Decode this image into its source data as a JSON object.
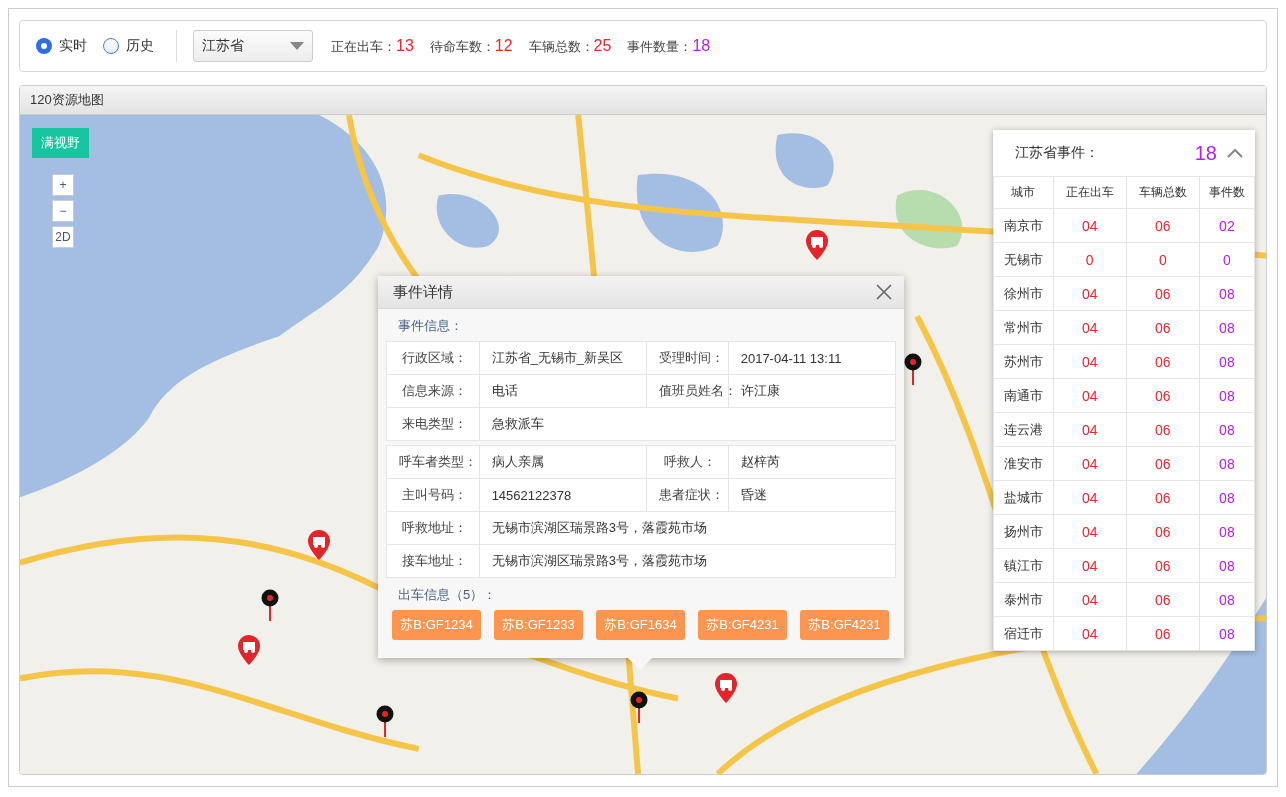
{
  "toolbar": {
    "mode_options": [
      {
        "label": "实时",
        "selected": true
      },
      {
        "label": "历史",
        "selected": false
      }
    ],
    "province_select": {
      "value": "江苏省"
    },
    "stats": [
      {
        "label": "正在出车：",
        "value": "13",
        "color": "#e8262d"
      },
      {
        "label": "待命车数：",
        "value": "12",
        "color": "#e8262d"
      },
      {
        "label": "车辆总数：",
        "value": "25",
        "color": "#e8262d"
      },
      {
        "label": "事件数量：",
        "value": "18",
        "color": "#b51ee8"
      }
    ]
  },
  "map_panel": {
    "title": "120资源地图",
    "fit_view_button": "满视野",
    "zoom_controls": [
      "+",
      "−",
      "2D"
    ]
  },
  "event_detail": {
    "title": "事件详情",
    "section_label": "事件信息：",
    "groups": [
      [
        [
          {
            "label": "行政区域：",
            "value": "江苏省_无锡市_新吴区"
          },
          {
            "label": "受理时间：",
            "value": "2017-04-11 13:11"
          }
        ],
        [
          {
            "label": "信息来源：",
            "value": "电话"
          },
          {
            "label": "值班员姓名：",
            "value": "许江康"
          }
        ],
        [
          {
            "label": "来电类型：",
            "value": "急救派车"
          }
        ]
      ],
      [
        [
          {
            "label": "呼车者类型：",
            "value": "病人亲属"
          },
          {
            "label": "呼救人：",
            "value": "赵梓芮"
          }
        ],
        [
          {
            "label": "主叫号码：",
            "value": "14562122378"
          },
          {
            "label": "患者症状：",
            "value": "昏迷"
          }
        ],
        [
          {
            "label": "呼救地址：",
            "value": "无锡市滨湖区瑞景路3号，落霞苑市场"
          }
        ],
        [
          {
            "label": "接车地址：",
            "value": "无锡市滨湖区瑞景路3号，落霞苑市场"
          }
        ]
      ]
    ],
    "vehicles_label": "出车信息（5）：",
    "vehicles": [
      "苏B:GF1234",
      "苏B:GF1233",
      "苏B:GF1634",
      "苏B:GF4231",
      "苏B:GF4231"
    ]
  },
  "province_events": {
    "title": "江苏省事件：",
    "count": "18",
    "expanded": true,
    "columns": [
      {
        "label": "城市"
      },
      {
        "label": "正在出车",
        "color": "#e8262d"
      },
      {
        "label": "车辆总数",
        "color": "#e8262d"
      },
      {
        "label": "事件数",
        "color": "#b51ee8"
      }
    ],
    "rows": [
      [
        "南京市",
        "04",
        "06",
        "02"
      ],
      [
        "无锡市",
        "0",
        "0",
        "0"
      ],
      [
        "徐州市",
        "04",
        "06",
        "08"
      ],
      [
        "常州市",
        "04",
        "06",
        "08"
      ],
      [
        "苏州市",
        "04",
        "06",
        "08"
      ],
      [
        "南通市",
        "04",
        "06",
        "08"
      ],
      [
        "连云港",
        "04",
        "06",
        "08"
      ],
      [
        "淮安市",
        "04",
        "06",
        "08"
      ],
      [
        "盐城市",
        "04",
        "06",
        "08"
      ],
      [
        "扬州市",
        "04",
        "06",
        "08"
      ],
      [
        "镇江市",
        "04",
        "06",
        "08"
      ],
      [
        "泰州市",
        "04",
        "06",
        "08"
      ],
      [
        "宿迁市",
        "04",
        "06",
        "08"
      ]
    ]
  }
}
